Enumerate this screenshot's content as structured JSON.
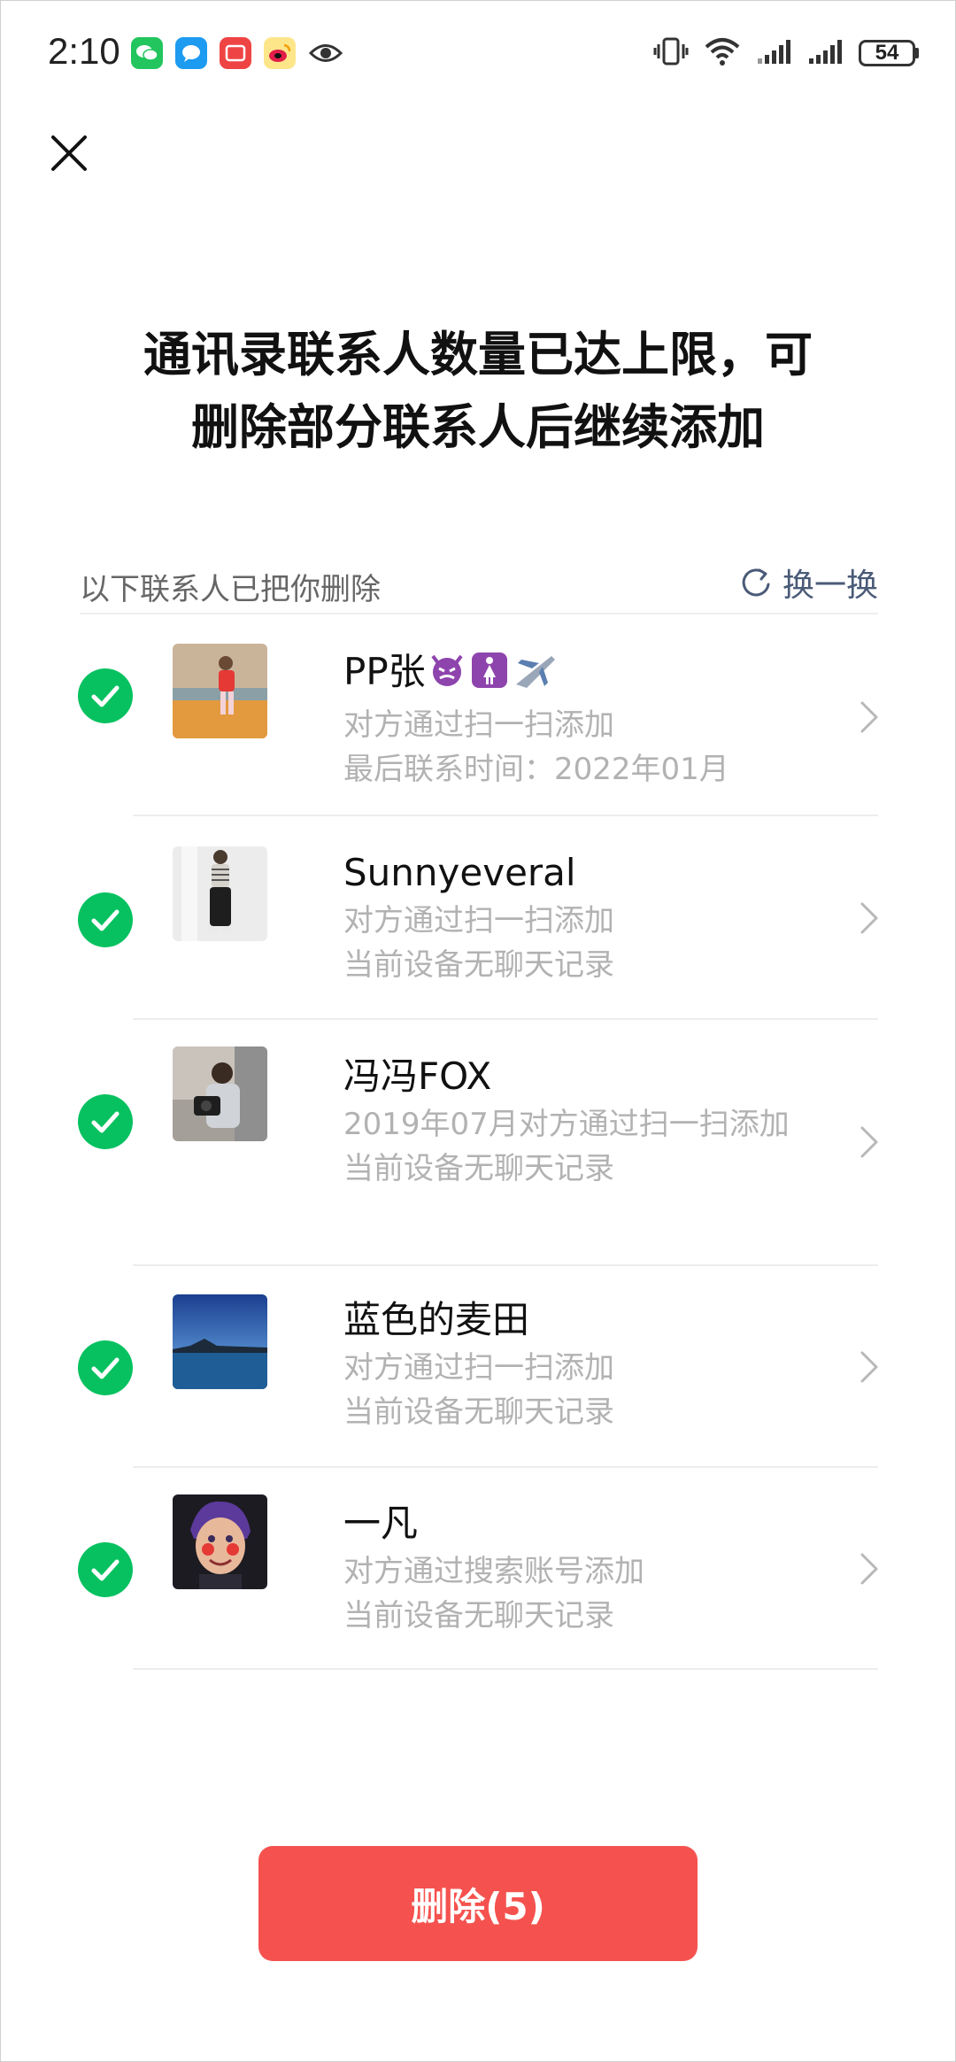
{
  "status_bar": {
    "time": "2:10",
    "battery": "54",
    "notification_icons": [
      "wechat-icon",
      "message-icon",
      "app-red-icon",
      "weibo-icon",
      "eye-icon"
    ],
    "system_icons": [
      "vibrate-icon",
      "wifi-icon",
      "signal-icon",
      "signal-icon",
      "battery-icon"
    ]
  },
  "header": {
    "close_icon": "close-icon",
    "title_line1": "通讯录联系人数量已达上限，可",
    "title_line2": "删除部分联系人后继续添加"
  },
  "section": {
    "label": "以下联系人已把你删除",
    "refresh_label": "换一换",
    "refresh_icon": "refresh-icon"
  },
  "contacts": [
    {
      "name": "PP张",
      "name_emoji": [
        "devil-emoji",
        "womens-room-emoji",
        "airplane-emoji"
      ],
      "meta_line1": "对方通过扫一扫添加",
      "meta_line2": "最后联系时间：2022年01月",
      "checked": true
    },
    {
      "name": "Sunnyeveral",
      "meta_line1": "对方通过扫一扫添加",
      "meta_line2": "当前设备无聊天记录",
      "checked": true
    },
    {
      "name": "冯冯FOX",
      "meta_line1": "2019年07月对方通过扫一扫添加",
      "meta_line2": "当前设备无聊天记录",
      "checked": true
    },
    {
      "name": "蓝色的麦田",
      "meta_line1": "对方通过扫一扫添加",
      "meta_line2": "当前设备无聊天记录",
      "checked": true
    },
    {
      "name": "一凡",
      "meta_line1": "对方通过搜索账号添加",
      "meta_line2": "当前设备无聊天记录",
      "checked": true
    }
  ],
  "footer": {
    "delete_label": "删除(5)"
  },
  "colors": {
    "check_green": "#07c160",
    "delete_red": "#f5524f",
    "meta_gray": "#b2b2b2",
    "link_blue_gray": "#4a5b78"
  }
}
